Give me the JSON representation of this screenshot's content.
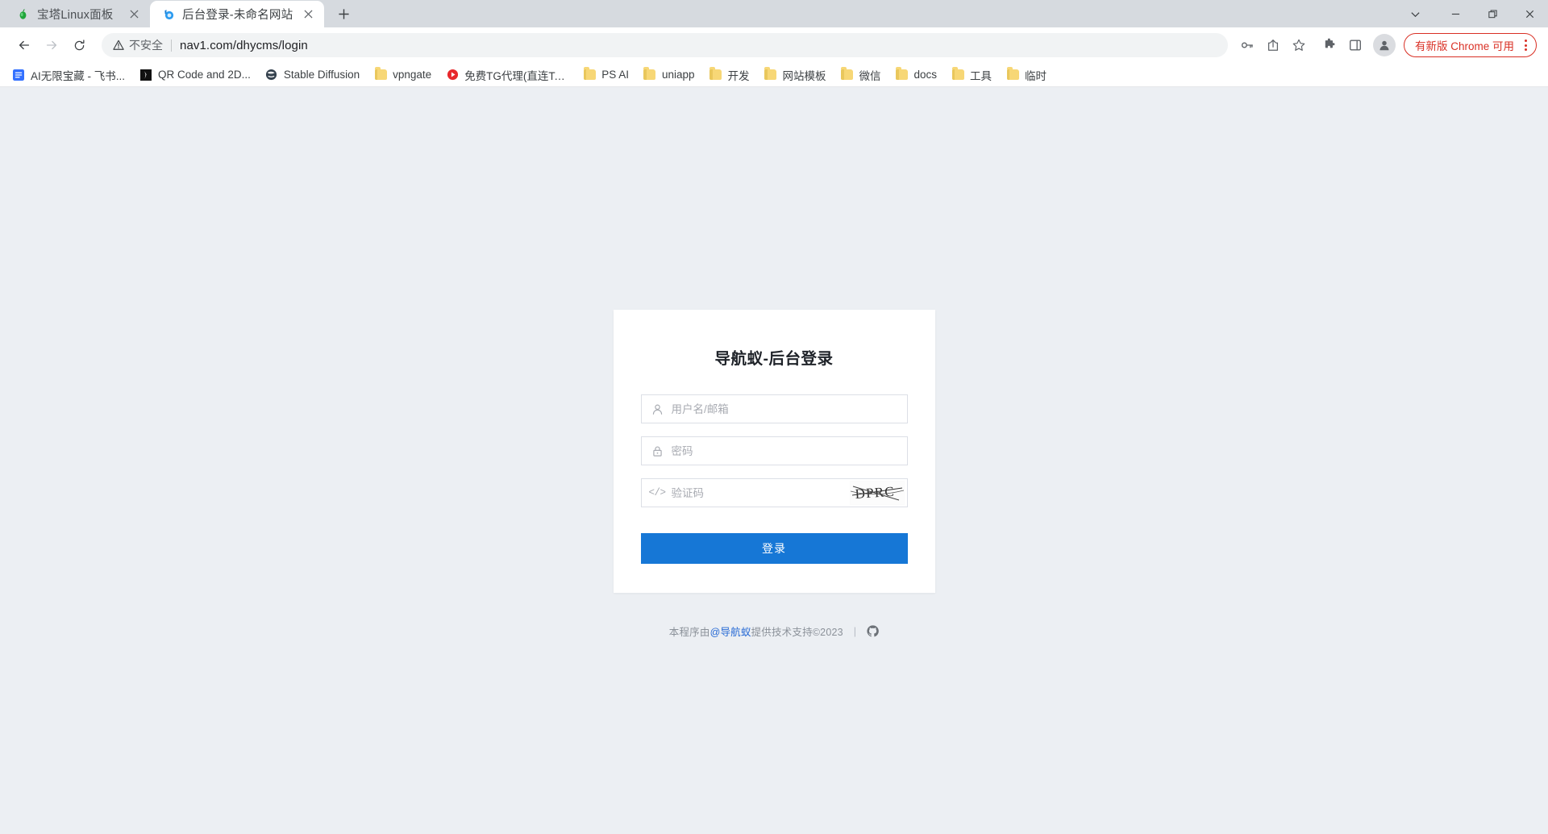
{
  "window": {
    "controls": [
      {
        "name": "tab-search-chevron",
        "glyph": "chevron-down-icon"
      },
      {
        "name": "minimize",
        "glyph": "minimize-icon"
      },
      {
        "name": "maximize",
        "glyph": "maximize-icon"
      },
      {
        "name": "close",
        "glyph": "close-icon"
      }
    ]
  },
  "tabs": [
    {
      "title": "宝塔Linux面板",
      "favicon": "bt-panel-icon",
      "active": false
    },
    {
      "title": "后台登录-未命名网站",
      "favicon": "site-blue-circle-icon",
      "active": true
    }
  ],
  "newtab_label": "+",
  "toolbar": {
    "back_icon": "back-arrow-icon",
    "forward_icon": "forward-arrow-icon",
    "reload_icon": "reload-icon",
    "security_text": "不安全",
    "url": "nav1.com/dhycms/login",
    "right_icons": [
      {
        "name": "password-key-icon"
      },
      {
        "name": "share-icon"
      },
      {
        "name": "bookmark-star-icon"
      },
      {
        "name": "extensions-puzzle-icon"
      },
      {
        "name": "side-panel-icon"
      }
    ],
    "avatar_icon": "profile-avatar-icon",
    "update_label": "有新版 Chrome 可用",
    "menu_icon": "three-dot-menu-icon"
  },
  "bookmarks": [
    {
      "label": "AI无限宝藏 - 飞书...",
      "icon": "doc-blue-icon"
    },
    {
      "label": "QR Code and 2D...",
      "icon": "qr-black-icon"
    },
    {
      "label": "Stable Diffusion",
      "icon": "globe-dark-icon"
    },
    {
      "label": "vpngate",
      "icon": "folder-icon"
    },
    {
      "label": "免费TG代理(直连Te...",
      "icon": "play-red-icon"
    },
    {
      "label": "PS AI",
      "icon": "folder-icon"
    },
    {
      "label": "uniapp",
      "icon": "folder-icon"
    },
    {
      "label": "开发",
      "icon": "folder-icon"
    },
    {
      "label": "网站模板",
      "icon": "folder-icon"
    },
    {
      "label": "微信",
      "icon": "folder-icon"
    },
    {
      "label": "docs",
      "icon": "folder-icon"
    },
    {
      "label": "工具",
      "icon": "folder-icon"
    },
    {
      "label": "临时",
      "icon": "folder-icon"
    }
  ],
  "login": {
    "title": "导航蚁-后台登录",
    "username": {
      "value": "",
      "placeholder": "用户名/邮箱",
      "icon": "user-icon"
    },
    "password": {
      "value": "",
      "placeholder": "密码",
      "icon": "lock-icon"
    },
    "captcha": {
      "value": "",
      "placeholder": "验证码",
      "icon": "code-tags-icon",
      "image_text": "DPRC"
    },
    "submit_label": "登录",
    "accent_color": "#1677d6"
  },
  "footer": {
    "prefix": "本程序由",
    "link": "@导航蚁",
    "suffix": "提供技术支持©2023",
    "separator": "|",
    "github_icon": "github-icon"
  },
  "colors": {
    "page_background": "#eceff3",
    "card_background": "#ffffff",
    "primary": "#1677d6",
    "tabstrip": "#d6dadf",
    "warning_red": "#d93025"
  }
}
